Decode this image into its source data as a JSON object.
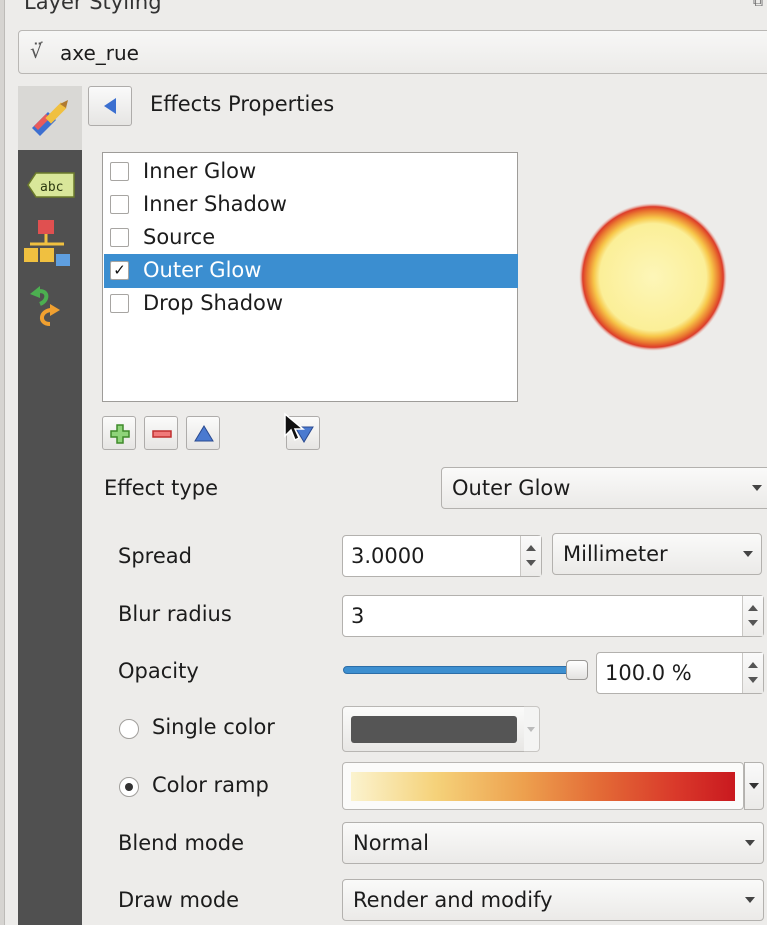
{
  "window": {
    "title": "Layer Styling"
  },
  "layer_selector": {
    "layer_name": "axe_rue"
  },
  "panel": {
    "title": "Effects Properties"
  },
  "effects_list": {
    "items": [
      {
        "label": "Inner Glow",
        "checked": false,
        "selected": false
      },
      {
        "label": "Inner Shadow",
        "checked": false,
        "selected": false
      },
      {
        "label": "Source",
        "checked": false,
        "selected": false
      },
      {
        "label": "Outer Glow",
        "checked": true,
        "selected": true
      },
      {
        "label": "Drop Shadow",
        "checked": false,
        "selected": false
      }
    ],
    "checkmark": "✓"
  },
  "effect_type": {
    "label": "Effect type",
    "value": "Outer Glow"
  },
  "spread": {
    "label": "Spread",
    "value": "3.0000",
    "unit": "Millimeter"
  },
  "blur_radius": {
    "label": "Blur radius",
    "value": "3"
  },
  "opacity": {
    "label": "Opacity",
    "value": "100.0 %",
    "fraction": 1.0
  },
  "color_options": {
    "single_color": {
      "label": "Single color",
      "selected": false,
      "color": "#555555"
    },
    "color_ramp": {
      "label": "Color ramp",
      "selected": true,
      "ramp_colors": [
        "#fbf3cf",
        "#f5d27a",
        "#e36a36",
        "#c9191f"
      ]
    }
  },
  "blend_mode": {
    "label": "Blend mode",
    "value": "Normal"
  },
  "draw_mode": {
    "label": "Draw mode",
    "value": "Render and modify"
  },
  "colors": {
    "selection": "#3b8ed0",
    "sidebar": "#505050",
    "accent": "#3d8fd0"
  }
}
